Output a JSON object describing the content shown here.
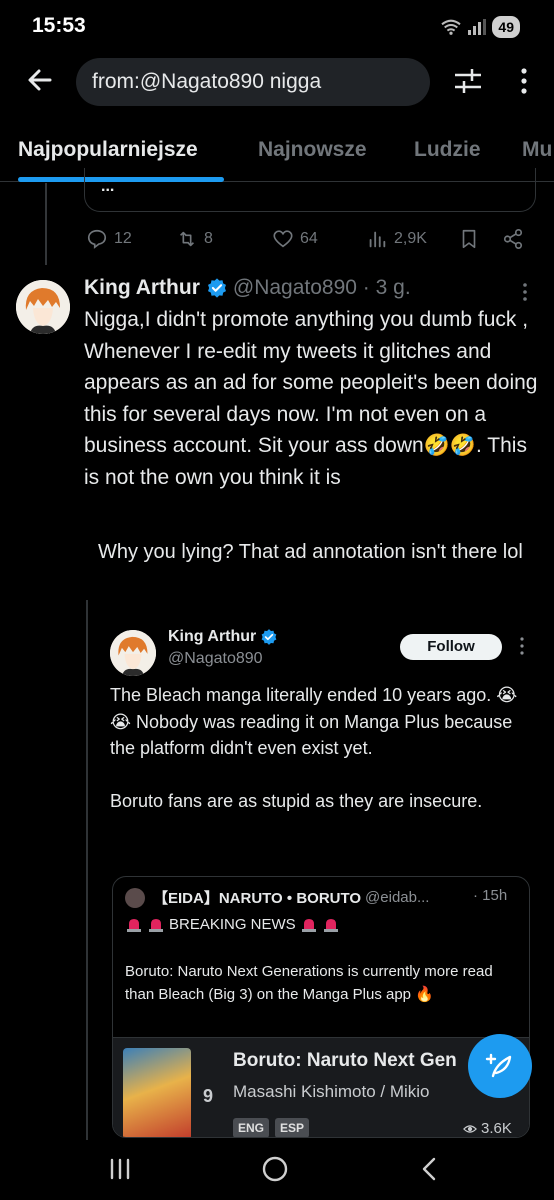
{
  "status_bar": {
    "time": "15:53",
    "battery": "49"
  },
  "search": {
    "query": "from:@Nagato890 nigga"
  },
  "tabs": [
    {
      "label": "Najpopularniejsze",
      "active": true
    },
    {
      "label": "Najnowsze",
      "active": false
    },
    {
      "label": "Ludzie",
      "active": false
    },
    {
      "label": "Mu",
      "active": false
    }
  ],
  "previous_tweet": {
    "card_text": "...",
    "replies": "12",
    "retweets": "8",
    "likes": "64",
    "views": "2,9K"
  },
  "tweet": {
    "name": "King Arthur",
    "handle": "@Nagato890",
    "time": "3 g.",
    "text": "Nigga,I didn't promote anything you dumb fuck , Whenever I re-edit my tweets it glitches and appears as an ad for some peopleit's been doing this for several days now. I'm not even on a business account. Sit your ass down🤣🤣. This is not the own you think it is"
  },
  "screenshot": {
    "reply_text": "Why you lying? That ad annotation isn't there lol",
    "quoted": {
      "name": "King Arthur",
      "handle": "@Nagato890",
      "follow_label": "Follow",
      "text": "The Bleach manga literally ended 10 years ago. 😭😭 Nobody was reading it on Manga Plus because the platform didn't even exist yet.\n\nBoruto fans are as stupid as they are insecure."
    },
    "inner": {
      "name": "【EIDA】NARUTO • BORUTO",
      "handle": "@eidab...",
      "time": "· 15h",
      "breaking": "BREAKING NEWS",
      "body": "Boruto: Naruto Next Generations is currently more read than Bleach (Big 3) on the Manga Plus app 🔥",
      "manga": {
        "rank": "9",
        "title": "Boruto: Naruto Next Gen",
        "author": "Masashi Kishimoto / Mikio",
        "langs": [
          "ENG",
          "ESP"
        ],
        "views": "3.6K"
      }
    }
  },
  "colors": {
    "accent": "#1d9bf0",
    "background": "#000000",
    "muted": "#71767b"
  }
}
